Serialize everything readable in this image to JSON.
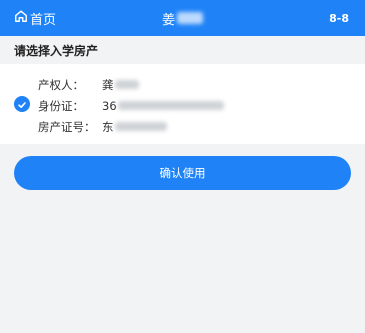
{
  "header": {
    "home_label": "首页",
    "title_visible": "姜",
    "code": "8-8"
  },
  "section": {
    "title": "请选择入学房产"
  },
  "property": {
    "selected": true,
    "owner": {
      "label": "产权人：",
      "value_visible": "龚"
    },
    "id_card": {
      "label": "身份证：",
      "value_visible": "36"
    },
    "cert_no": {
      "label": "房产证号：",
      "value_visible": "东"
    }
  },
  "confirm_button": {
    "label": "确认使用"
  },
  "colors": {
    "primary": "#1f83f7",
    "background": "#f2f3f5"
  },
  "icons": {
    "home": "home-icon",
    "check": "checkmark-icon"
  }
}
